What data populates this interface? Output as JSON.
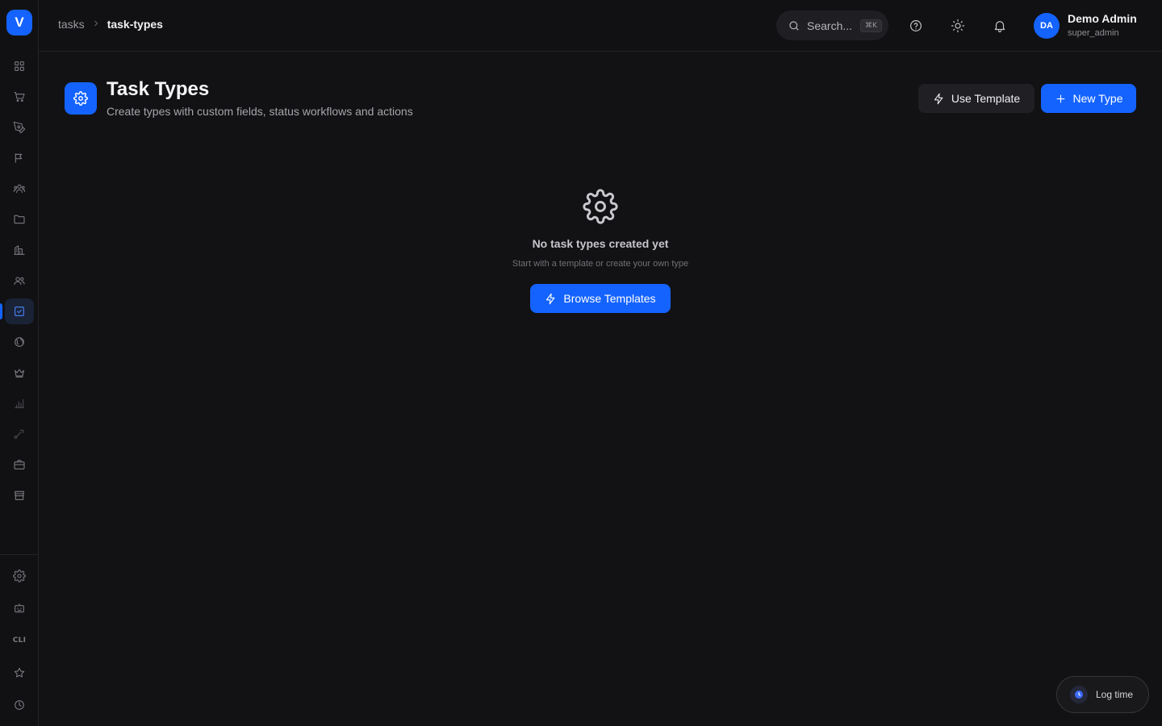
{
  "app": {
    "logo_letter": "V"
  },
  "breadcrumb": {
    "items": [
      "tasks",
      "task-types"
    ]
  },
  "search": {
    "placeholder": "Search...",
    "shortcut": "⌘K"
  },
  "user": {
    "initials": "DA",
    "name": "Demo Admin",
    "role": "super_admin"
  },
  "page": {
    "title": "Task Types",
    "subtitle": "Create types with custom fields, status workflows and actions",
    "use_template_label": "Use Template",
    "new_type_label": "New Type"
  },
  "empty_state": {
    "title": "No task types created yet",
    "subtitle": "Start with a template or create your own type",
    "browse_label": "Browse Templates"
  },
  "sidebar": {
    "cli_label": "CLI",
    "items": [
      "grid-icon",
      "cart-icon",
      "pen-tool-icon",
      "megaphone-icon",
      "users-group-icon",
      "folder-icon",
      "building-icon",
      "contacts-icon",
      "check-square-icon",
      "globe-icon",
      "crown-icon",
      "bar-chart-icon",
      "route-icon",
      "briefcase-icon",
      "store-icon"
    ],
    "bottom_items": [
      "settings-icon",
      "bot-icon",
      "cli-icon",
      "star-icon",
      "clock-icon"
    ]
  },
  "log_time": {
    "label": "Log time"
  },
  "colors": {
    "accent": "#1463ff",
    "background": "#121214"
  }
}
